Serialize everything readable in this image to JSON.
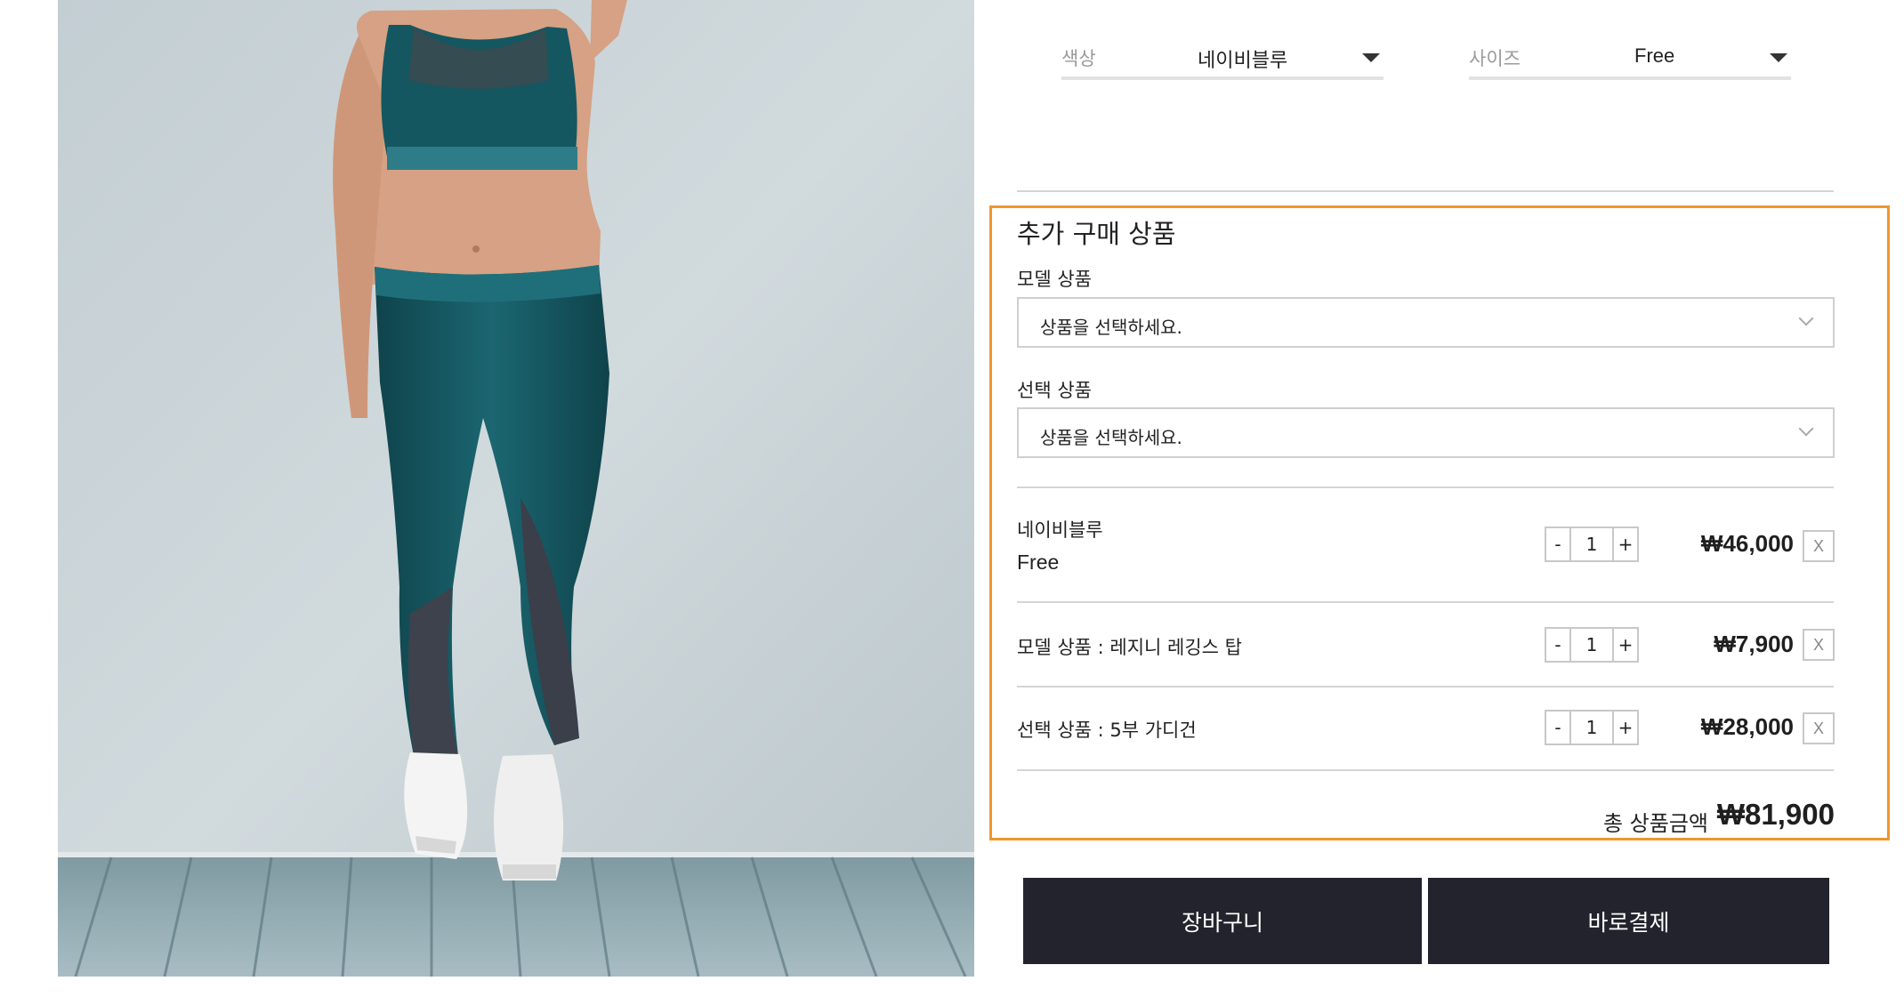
{
  "product_image": {
    "alt": "",
    "colors": {
      "wall": "#c9d3d7",
      "floor": "#8fa9b0",
      "outfit": "#15565f",
      "skin": "#d6a184",
      "shoe": "#f3f3f3"
    }
  },
  "options": {
    "color": {
      "label": "색상",
      "value": "네이비블루"
    },
    "size": {
      "label": "사이즈",
      "value": "Free"
    }
  },
  "addon": {
    "title": "추가 구매 상품",
    "model": {
      "label": "모델 상품",
      "placeholder": "상품을 선택하세요."
    },
    "choice": {
      "label": "선택 상품",
      "placeholder": "상품을 선택하세요."
    }
  },
  "cart": {
    "lines": [
      {
        "name": "네이비블루",
        "sub": "Free",
        "qty": "1",
        "price": "₩46,000",
        "remove": "X"
      },
      {
        "name": "모델 상품 : 레지니 레깅스 탑",
        "qty": "1",
        "price": "₩7,900",
        "remove": "X"
      },
      {
        "name": "선택 상품 : 5부 가디건",
        "qty": "1",
        "price": "₩28,000",
        "remove": "X"
      }
    ],
    "minus": "-",
    "plus": "+"
  },
  "total": {
    "label": "총 상품금액",
    "value": "₩81,900"
  },
  "buttons": {
    "cart": "장바구니",
    "buy_now": "바로결제"
  },
  "colors": {
    "highlight": "#f0962e",
    "button_bg": "#23232d"
  }
}
